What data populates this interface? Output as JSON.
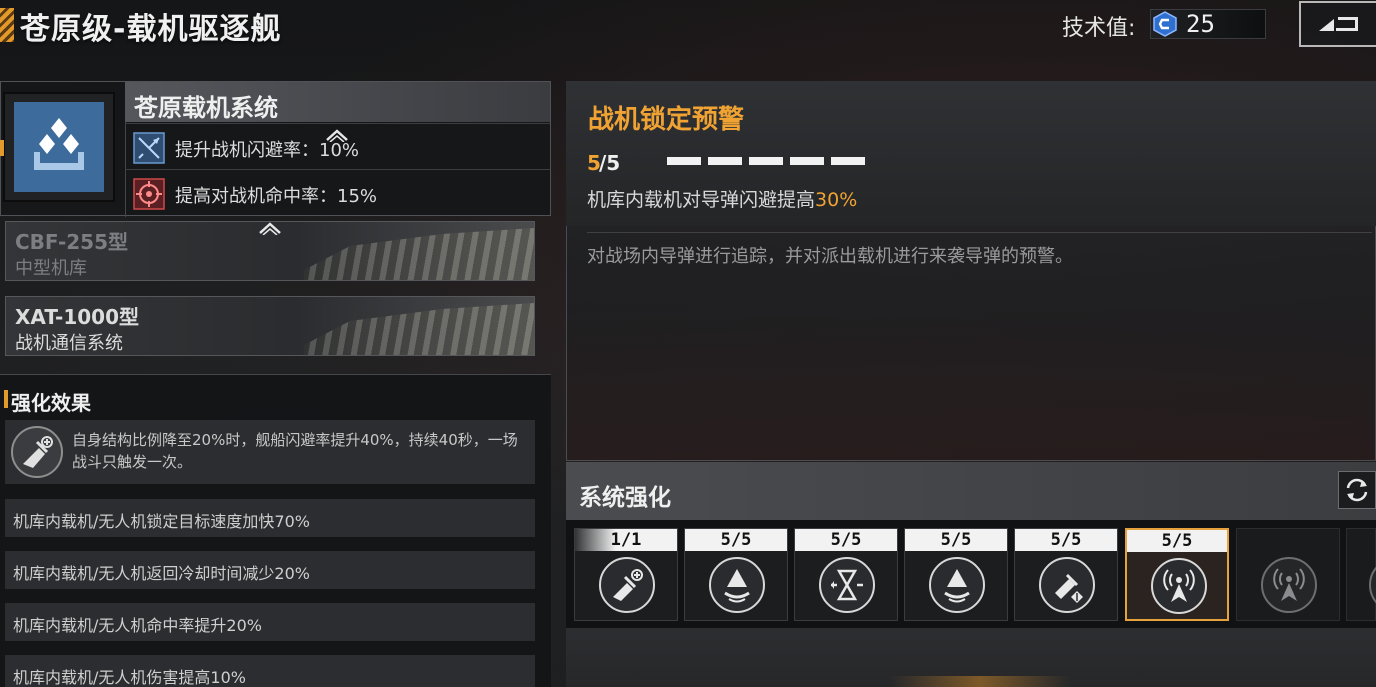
{
  "header": {
    "title": "苍原级-载机驱逐舰",
    "tech_label": "技术值:",
    "tech_value": "25",
    "back_icon": "back-return-icon"
  },
  "module": {
    "name": "苍原载机系统",
    "icon": "hangar-carrier-icon",
    "stats": [
      {
        "icon": "fighter-evasion-icon",
        "text": "提升战机闪避率：10%"
      },
      {
        "icon": "target-crosshair-icon",
        "text": "提高对战机命中率：15%"
      }
    ]
  },
  "hangars": [
    {
      "code": "CBF-255型",
      "type": "中型机库"
    },
    {
      "code": "XAT-1000型",
      "type": "战机通信系统"
    }
  ],
  "effects": {
    "heading": "强化效果",
    "main": "自身结构比例降至20%时，舰船闪避率提升40%，持续40秒，一场战斗只触发一次。",
    "rows": [
      "机库内载机/无人机锁定目标速度加快70%",
      "机库内载机/无人机返回冷却时间减少20%",
      "机库内载机/无人机命中率提升20%",
      "机库内载机/无人机伤害提高10%"
    ]
  },
  "detail": {
    "title": "战机锁定预警",
    "level_current": "5",
    "level_max": "/5",
    "pips": 5,
    "effect_prefix": "机库内载机对导弹闪避提高",
    "effect_value": "30%",
    "description": "对战场内导弹进行追踪，并对派出载机进行来袭导弹的预警。"
  },
  "upgrade": {
    "title": "系统强化",
    "refresh_icon": "refresh-icon",
    "prev_glyph": "《",
    "nodes": [
      {
        "count": "1/1",
        "icon": "fighter-evasion-icon"
      },
      {
        "count": "5/5",
        "icon": "fighter-up-icon"
      },
      {
        "count": "5/5",
        "icon": "hourglass-cooldown-icon"
      },
      {
        "count": "5/5",
        "icon": "fighter-accuracy-icon"
      },
      {
        "count": "5/5",
        "icon": "cannon-damage-icon"
      },
      {
        "count": "5/5",
        "icon": "radar-warning-icon"
      },
      {
        "count": "",
        "icon": "radar-locked-icon"
      },
      {
        "count": "",
        "icon": "locked-node-icon"
      }
    ]
  },
  "colors": {
    "accent": "#f0a333",
    "module_blue": "#3d6b9c"
  }
}
